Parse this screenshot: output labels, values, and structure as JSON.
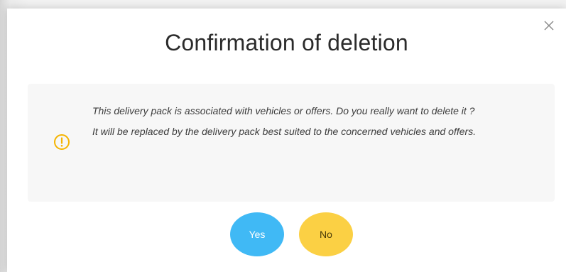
{
  "dialog": {
    "title": "Confirmation of deletion",
    "close_icon": "close-icon",
    "message_line1": "This delivery pack is associated with vehicles or offers. Do you really want to delete it ?",
    "message_line2": "It will be replaced by the delivery pack best suited to the concerned vehicles and offers.",
    "alert_icon": "warning-icon",
    "yes_label": "Yes",
    "no_label": "No"
  },
  "colors": {
    "yes_button": "#40b9f5",
    "no_button": "#fbd044",
    "warning_icon": "#f5b400",
    "alert_background": "#f7f7f7"
  }
}
